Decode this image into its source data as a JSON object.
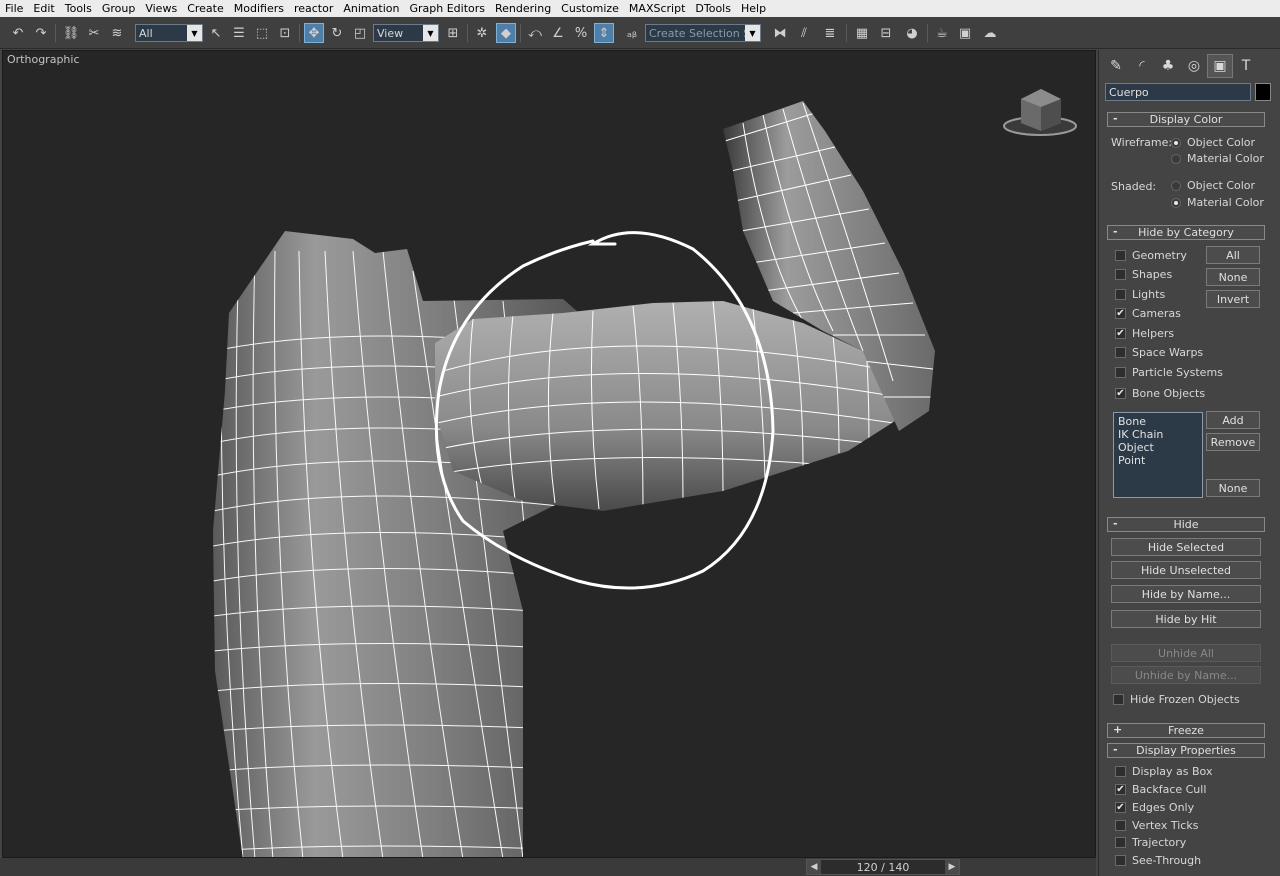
{
  "menu": [
    "File",
    "Edit",
    "Tools",
    "Group",
    "Views",
    "Create",
    "Modifiers",
    "reactor",
    "Animation",
    "Graph Editors",
    "Rendering",
    "Customize",
    "MAXScript",
    "DTools",
    "Help"
  ],
  "toolbar": {
    "filter_value": "All",
    "refcoord_value": "View",
    "selection_set_placeholder": "Create Selection Se"
  },
  "viewport": {
    "label": "Orthographic"
  },
  "timeline": {
    "frame_label": "120 / 140"
  },
  "panel": {
    "object_name": "Cuerpo",
    "object_color": "#000000",
    "display_color": {
      "title": "Display Color",
      "wireframe_label": "Wireframe:",
      "shaded_label": "Shaded:",
      "wire_options": [
        "Object Color",
        "Material Color"
      ],
      "shaded_options": [
        "Object Color",
        "Material Color"
      ]
    },
    "hide_by_category": {
      "title": "Hide by Category",
      "items": [
        {
          "label": "Geometry",
          "checked": false
        },
        {
          "label": "Shapes",
          "checked": false
        },
        {
          "label": "Lights",
          "checked": false
        },
        {
          "label": "Cameras",
          "checked": true
        },
        {
          "label": "Helpers",
          "checked": true
        },
        {
          "label": "Space Warps",
          "checked": false
        },
        {
          "label": "Particle Systems",
          "checked": false
        },
        {
          "label": "Bone Objects",
          "checked": true
        }
      ],
      "all_btn": "All",
      "none_btn": "None",
      "invert_btn": "Invert",
      "list": [
        "Bone",
        "IK Chain Object",
        "Point"
      ],
      "add_btn": "Add",
      "remove_btn": "Remove",
      "none2_btn": "None"
    },
    "hide": {
      "title": "Hide",
      "buttons": [
        "Hide Selected",
        "Hide Unselected",
        "Hide by Name...",
        "Hide by Hit",
        "Unhide All",
        "Unhide by Name..."
      ],
      "frozen_label": "Hide Frozen Objects"
    },
    "freeze": {
      "title": "Freeze"
    },
    "display_properties": {
      "title": "Display Properties",
      "items": [
        {
          "label": "Display as Box",
          "checked": false
        },
        {
          "label": "Backface Cull",
          "checked": true
        },
        {
          "label": "Edges Only",
          "checked": true
        },
        {
          "label": "Vertex Ticks",
          "checked": false
        },
        {
          "label": "Trajectory",
          "checked": false
        },
        {
          "label": "See-Through",
          "checked": false
        }
      ]
    }
  }
}
